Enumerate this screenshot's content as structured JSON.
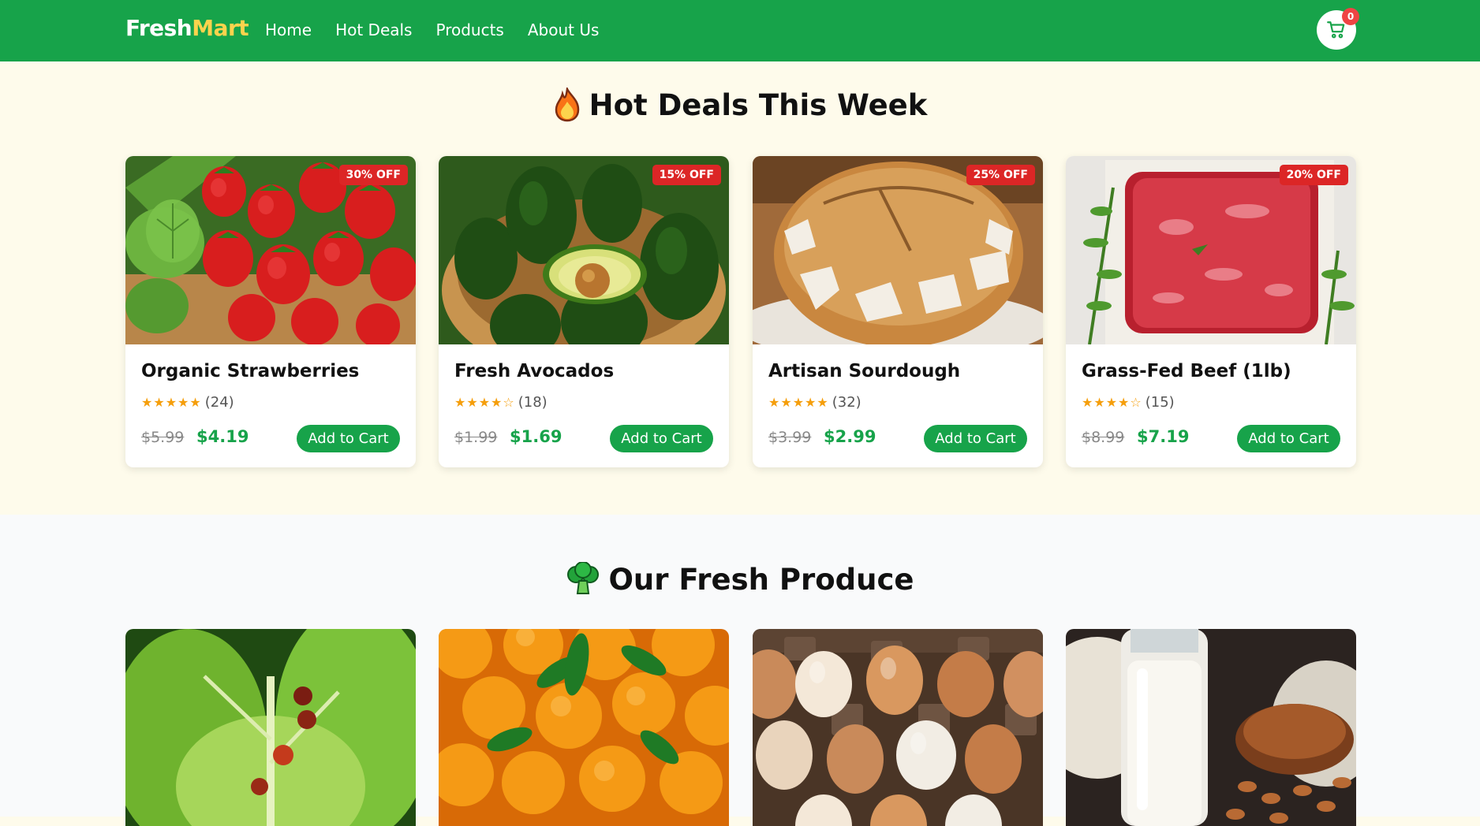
{
  "header": {
    "logo_main": "Fresh",
    "logo_accent": "Mart",
    "nav": [
      "Home",
      "Hot Deals",
      "Products",
      "About Us"
    ],
    "cart_count": "0",
    "cart_icon": "cart-icon"
  },
  "deals": {
    "title": "Hot Deals This Week",
    "title_icon": "fire-icon",
    "items": [
      {
        "name": "Organic Strawberries",
        "badge": "30% OFF",
        "stars": "★★★★★",
        "reviews": "(24)",
        "old_price": "$5.99",
        "new_price": "$4.19",
        "button": "Add to Cart"
      },
      {
        "name": "Fresh Avocados",
        "badge": "15% OFF",
        "stars": "★★★★☆",
        "reviews": "(18)",
        "old_price": "$1.99",
        "new_price": "$1.69",
        "button": "Add to Cart"
      },
      {
        "name": "Artisan Sourdough",
        "badge": "25% OFF",
        "stars": "★★★★★",
        "reviews": "(32)",
        "old_price": "$3.99",
        "new_price": "$2.99",
        "button": "Add to Cart"
      },
      {
        "name": "Grass-Fed Beef (1lb)",
        "badge": "20% OFF",
        "stars": "★★★★☆",
        "reviews": "(15)",
        "old_price": "$8.99",
        "new_price": "$7.19",
        "button": "Add to Cart"
      }
    ]
  },
  "produce": {
    "title": "Our Fresh Produce",
    "title_icon": "broccoli-icon"
  },
  "colors": {
    "brand_green": "#17a34a",
    "accent_yellow": "#fcd34d",
    "badge_red": "#dc2626"
  }
}
